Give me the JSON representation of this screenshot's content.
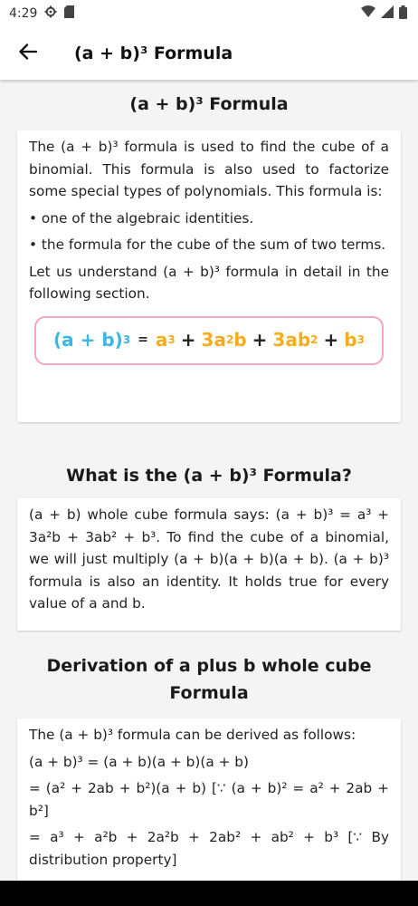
{
  "status": {
    "time": "4:29",
    "colors": {
      "icons": "#333333"
    }
  },
  "app_bar": {
    "title": "(a + b)³ Formula"
  },
  "section1": {
    "heading": "(a + b)³ Formula",
    "intro": "The (a + b)³ formula is used to find the cube of a binomial. This formula is also used to factorize some special types of polynomials. This formula is:",
    "bullet1": "• one of the algebraic identities.",
    "bullet2": "• the formula for the cube of the sum of two terms.",
    "outro": "Let us understand (a + b)³ formula in detail in the following section.",
    "formula": {
      "lhs": "(a + b)",
      "lhs_exp": "3",
      "eq": "=",
      "t1": "a",
      "t1_exp": "3",
      "plus": "+",
      "t2a": "3a",
      "t2_exp": "2",
      "t2b": "b",
      "t3a": "3ab",
      "t3_exp": "2",
      "t4": "b",
      "t4_exp": "3"
    }
  },
  "section2": {
    "heading": "What is the (a + b)³ Formula?",
    "body": "(a + b) whole cube formula says: (a + b)³ = a³ + 3a²b + 3ab² + b³. To find the cube of a binomial, we will just multiply (a + b)(a + b)(a + b). (a + b)³ formula is also an identity. It holds true for every value of a and b."
  },
  "section3": {
    "heading": "Derivation of a plus b whole cube Formula",
    "line1": "The (a + b)³ formula can be derived as follows:",
    "line2": "(a + b)³ = (a + b)(a + b)(a + b)",
    "line3": "= (a² + 2ab + b²)(a + b) [∵ (a + b)² = a² + 2ab + b²]",
    "line4": "= a³ + a²b + 2a²b + 2ab² + ab² + b³ [∵ By distribution property]"
  },
  "colors": {
    "accent_blue": "#3cb6e6",
    "accent_orange": "#f5ad1b",
    "formula_border": "#f2a5bf"
  }
}
